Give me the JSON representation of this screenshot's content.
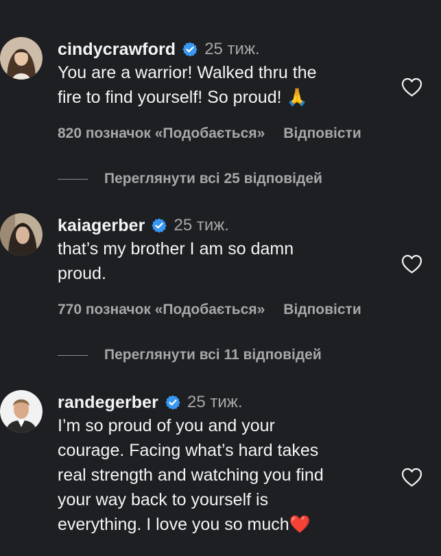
{
  "comments": [
    {
      "username": "cindycrawford",
      "verified": true,
      "time": "25 тиж.",
      "text_lines": [
        "You are a warrior! Walked thru the",
        "fire to find yourself! So proud! 🙏"
      ],
      "likes": "820 позначок «Подобається»",
      "reply_label": "Відповісти",
      "view_replies": "Переглянути всі 25 відповідей",
      "heart_icon": "heart-outline-icon"
    },
    {
      "username": "kaiagerber",
      "verified": true,
      "time": "25 тиж.",
      "text_lines": [
        "that’s my brother I am so damn",
        "proud."
      ],
      "likes": "770 позначок «Подобається»",
      "reply_label": "Відповісти",
      "view_replies": "Переглянути всі 11 відповідей",
      "heart_icon": "heart-outline-icon"
    },
    {
      "username": "randegerber",
      "verified": true,
      "time": "25 тиж.",
      "text_lines": [
        "I’m so proud of you and your",
        "courage. Facing what’s hard takes",
        "real strength and watching you find",
        "your way back to yourself is",
        "everything. I love you so much❤️"
      ],
      "heart_icon": "heart-outline-icon"
    }
  ],
  "colors": {
    "background": "#1d1f23",
    "primary_text": "#f5f5f5",
    "secondary_text": "#a8a8a8",
    "verified_badge": "#3897f0"
  }
}
